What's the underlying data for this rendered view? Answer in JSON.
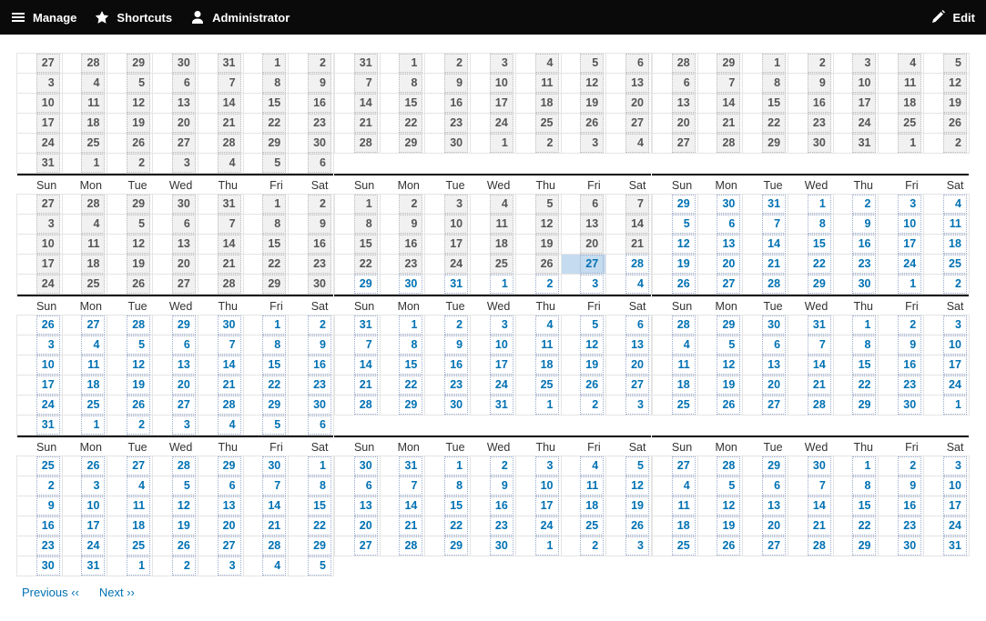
{
  "toolbar": {
    "manage": "Manage",
    "shortcuts": "Shortcuts",
    "admin": "Administrator",
    "edit": "Edit"
  },
  "day_headers": [
    "Sun",
    "Mon",
    "Tue",
    "Wed",
    "Thu",
    "Fri",
    "Sat"
  ],
  "pager": {
    "prev": "Previous ‹‹",
    "next": "Next ››"
  },
  "today": {
    "month_index": 4,
    "day": 27
  },
  "future_start": {
    "month_index": 4,
    "day": 27
  },
  "months": [
    {
      "weeks": [
        [
          27,
          28,
          29,
          30,
          31,
          1,
          2
        ],
        [
          3,
          4,
          5,
          6,
          7,
          8,
          9
        ],
        [
          10,
          11,
          12,
          13,
          14,
          15,
          16
        ],
        [
          17,
          18,
          19,
          20,
          21,
          22,
          23
        ],
        [
          24,
          25,
          26,
          27,
          28,
          29,
          30
        ],
        [
          31,
          1,
          2,
          3,
          4,
          5,
          6
        ]
      ]
    },
    {
      "weeks": [
        [
          31,
          1,
          2,
          3,
          4,
          5,
          6
        ],
        [
          7,
          8,
          9,
          10,
          11,
          12,
          13
        ],
        [
          14,
          15,
          16,
          17,
          18,
          19,
          20
        ],
        [
          21,
          22,
          23,
          24,
          25,
          26,
          27
        ],
        [
          28,
          29,
          30,
          1,
          2,
          3,
          4
        ]
      ]
    },
    {
      "weeks": [
        [
          28,
          29,
          1,
          2,
          3,
          4,
          5
        ],
        [
          6,
          7,
          8,
          9,
          10,
          11,
          12
        ],
        [
          13,
          14,
          15,
          16,
          17,
          18,
          19
        ],
        [
          20,
          21,
          22,
          23,
          24,
          25,
          26
        ],
        [
          27,
          28,
          29,
          30,
          31,
          1,
          2
        ]
      ]
    },
    {
      "weeks": [
        [
          27,
          28,
          29,
          30,
          31,
          1,
          2
        ],
        [
          3,
          4,
          5,
          6,
          7,
          8,
          9
        ],
        [
          10,
          11,
          12,
          13,
          14,
          15,
          16
        ],
        [
          17,
          18,
          19,
          20,
          21,
          22,
          23
        ],
        [
          24,
          25,
          26,
          27,
          28,
          29,
          30
        ]
      ]
    },
    {
      "weeks": [
        [
          1,
          2,
          3,
          4,
          5,
          6,
          7
        ],
        [
          8,
          9,
          10,
          11,
          12,
          13,
          14
        ],
        [
          15,
          16,
          17,
          18,
          19,
          20,
          21
        ],
        [
          22,
          23,
          24,
          25,
          26,
          27,
          28
        ],
        [
          29,
          30,
          31,
          1,
          2,
          3,
          4
        ]
      ]
    },
    {
      "weeks": [
        [
          29,
          30,
          31,
          1,
          2,
          3,
          4
        ],
        [
          5,
          6,
          7,
          8,
          9,
          10,
          11
        ],
        [
          12,
          13,
          14,
          15,
          16,
          17,
          18
        ],
        [
          19,
          20,
          21,
          22,
          23,
          24,
          25
        ],
        [
          26,
          27,
          28,
          29,
          30,
          1,
          2
        ]
      ]
    },
    {
      "weeks": [
        [
          26,
          27,
          28,
          29,
          30,
          1,
          2
        ],
        [
          3,
          4,
          5,
          6,
          7,
          8,
          9
        ],
        [
          10,
          11,
          12,
          13,
          14,
          15,
          16
        ],
        [
          17,
          18,
          19,
          20,
          21,
          22,
          23
        ],
        [
          24,
          25,
          26,
          27,
          28,
          29,
          30
        ],
        [
          31,
          1,
          2,
          3,
          4,
          5,
          6
        ]
      ]
    },
    {
      "weeks": [
        [
          31,
          1,
          2,
          3,
          4,
          5,
          6
        ],
        [
          7,
          8,
          9,
          10,
          11,
          12,
          13
        ],
        [
          14,
          15,
          16,
          17,
          18,
          19,
          20
        ],
        [
          21,
          22,
          23,
          24,
          25,
          26,
          27
        ],
        [
          28,
          29,
          30,
          31,
          1,
          2,
          3
        ]
      ]
    },
    {
      "weeks": [
        [
          28,
          29,
          30,
          31,
          1,
          2,
          3
        ],
        [
          4,
          5,
          6,
          7,
          8,
          9,
          10
        ],
        [
          11,
          12,
          13,
          14,
          15,
          16,
          17
        ],
        [
          18,
          19,
          20,
          21,
          22,
          23,
          24
        ],
        [
          25,
          26,
          27,
          28,
          29,
          30,
          1
        ]
      ]
    },
    {
      "weeks": [
        [
          25,
          26,
          27,
          28,
          29,
          30,
          1
        ],
        [
          2,
          3,
          4,
          5,
          6,
          7,
          8
        ],
        [
          9,
          10,
          11,
          12,
          13,
          14,
          15
        ],
        [
          16,
          17,
          18,
          19,
          20,
          21,
          22
        ],
        [
          23,
          24,
          25,
          26,
          27,
          28,
          29
        ],
        [
          30,
          31,
          1,
          2,
          3,
          4,
          5
        ]
      ]
    },
    {
      "weeks": [
        [
          30,
          31,
          1,
          2,
          3,
          4,
          5
        ],
        [
          6,
          7,
          8,
          9,
          10,
          11,
          12
        ],
        [
          13,
          14,
          15,
          16,
          17,
          18,
          19
        ],
        [
          20,
          21,
          22,
          23,
          24,
          25,
          26
        ],
        [
          27,
          28,
          29,
          30,
          1,
          2,
          3
        ]
      ]
    },
    {
      "weeks": [
        [
          27,
          28,
          29,
          30,
          1,
          2,
          3
        ],
        [
          4,
          5,
          6,
          7,
          8,
          9,
          10
        ],
        [
          11,
          12,
          13,
          14,
          15,
          16,
          17
        ],
        [
          18,
          19,
          20,
          21,
          22,
          23,
          24
        ],
        [
          25,
          26,
          27,
          28,
          29,
          30,
          31
        ]
      ]
    }
  ]
}
